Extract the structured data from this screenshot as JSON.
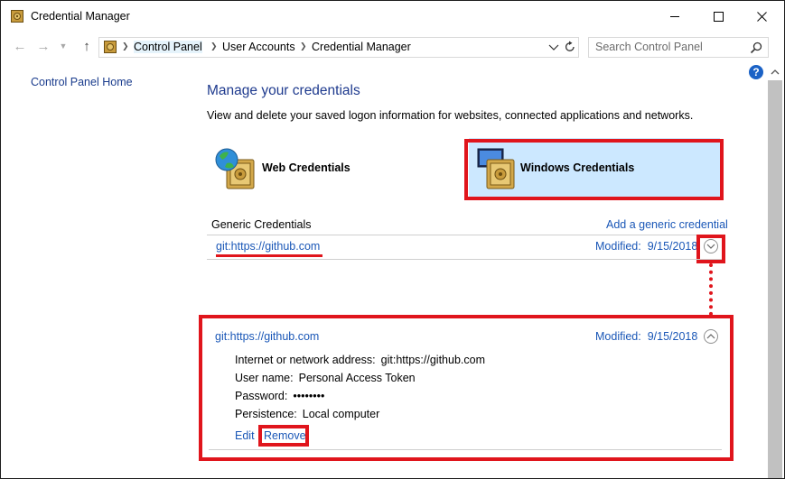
{
  "window": {
    "title": "Credential Manager"
  },
  "address": {
    "crumbs": [
      "Control Panel",
      "User Accounts",
      "Credential Manager"
    ]
  },
  "search": {
    "placeholder": "Search Control Panel"
  },
  "left_nav": {
    "home_link": "Control Panel Home"
  },
  "main": {
    "heading": "Manage your credentials",
    "subtitle": "View and delete your saved logon information for websites, connected applications and networks.",
    "tiles": {
      "web": "Web Credentials",
      "windows": "Windows Credentials",
      "selected": "windows"
    },
    "generic": {
      "section_label": "Generic Credentials",
      "add_link": "Add a generic credential",
      "collapsed": {
        "name": "git:https://github.com",
        "modified_label": "Modified:",
        "modified_date": "9/15/2018"
      },
      "expanded": {
        "name": "git:https://github.com",
        "modified_label": "Modified:",
        "modified_date": "9/15/2018",
        "address_label": "Internet or network address:",
        "address_value": "git:https://github.com",
        "user_label": "User name:",
        "user_value": "Personal Access Token",
        "password_label": "Password:",
        "password_value": "••••••••",
        "persistence_label": "Persistence:",
        "persistence_value": "Local computer",
        "edit_label": "Edit",
        "remove_label": "Remove"
      }
    }
  },
  "colors": {
    "accent_link": "#1a57b7",
    "heading": "#1e3a8e",
    "annotation_red": "#e0151c",
    "selected_tile": "#cce8ff"
  }
}
